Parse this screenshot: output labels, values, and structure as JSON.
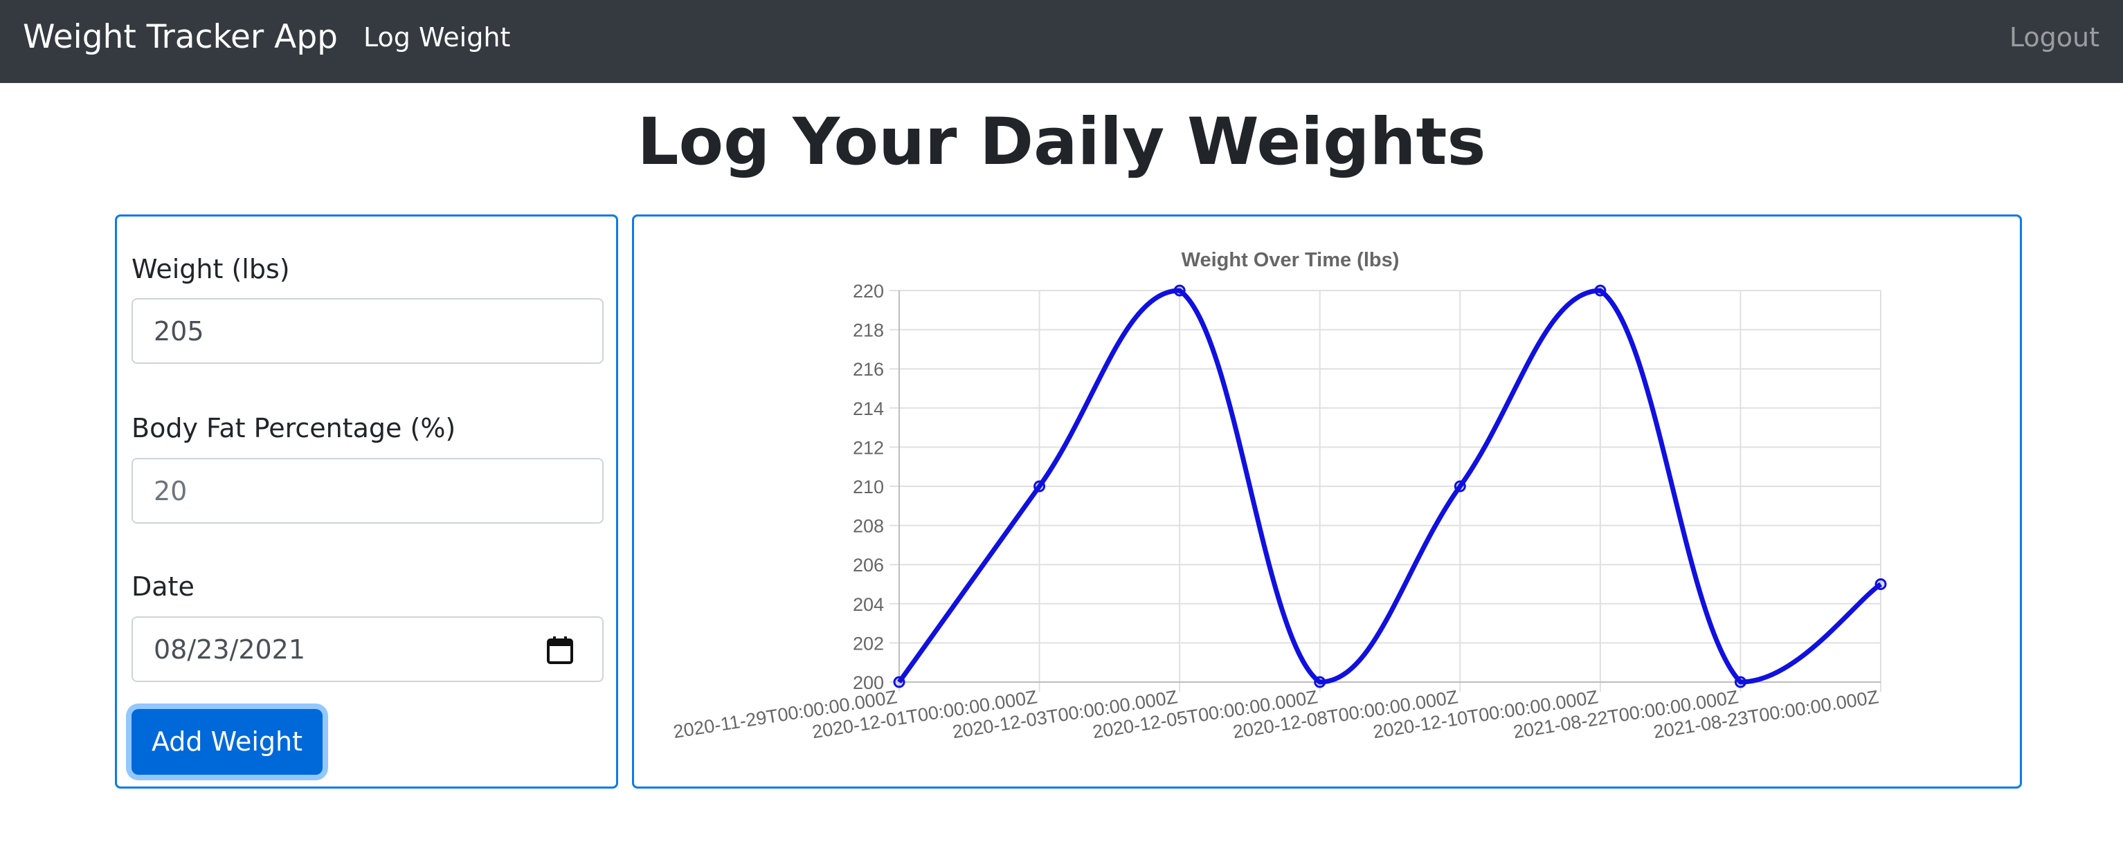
{
  "navbar": {
    "brand": "Weight Tracker App",
    "link_log_weight": "Log Weight",
    "logout": "Logout"
  },
  "page": {
    "title": "Log Your Daily Weights"
  },
  "form": {
    "weight_label": "Weight (lbs)",
    "weight_value": "205",
    "bodyfat_label": "Body Fat Percentage (%)",
    "bodyfat_placeholder": "20",
    "date_label": "Date",
    "date_value": "08/23/2021",
    "submit_label": "Add Weight"
  },
  "colors": {
    "navbar_bg": "#343a40",
    "panel_border": "#0d7be8",
    "button_bg": "#0069d9",
    "series_line": "#1010e0"
  },
  "chart_data": {
    "type": "line",
    "title": "Weight Over Time (lbs)",
    "xlabel": "",
    "ylabel": "",
    "categories": [
      "2020-11-29T00:00:00.000Z",
      "2020-12-01T00:00:00.000Z",
      "2020-12-03T00:00:00.000Z",
      "2020-12-05T00:00:00.000Z",
      "2020-12-08T00:00:00.000Z",
      "2020-12-10T00:00:00.000Z",
      "2021-08-22T00:00:00.000Z",
      "2021-08-23T00:00:00.000Z"
    ],
    "values": [
      200,
      210,
      220,
      200,
      210,
      220,
      200,
      205
    ],
    "ylim": [
      200,
      220
    ],
    "yticks": [
      200,
      202,
      204,
      206,
      208,
      210,
      212,
      214,
      216,
      218,
      220
    ],
    "grid": true,
    "legend": "none"
  }
}
